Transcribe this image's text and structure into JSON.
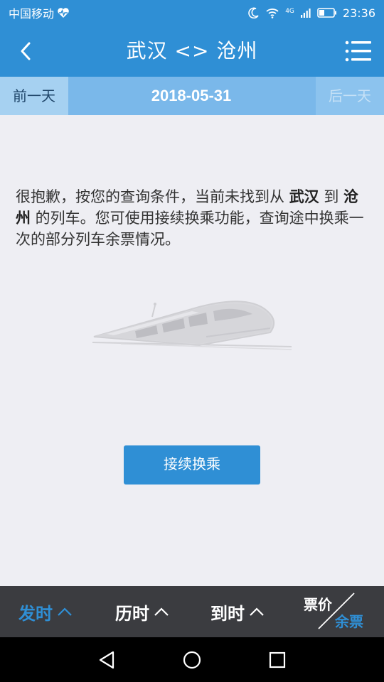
{
  "status_bar": {
    "carrier": "中国移动",
    "network": "4G",
    "time": "23:36"
  },
  "header": {
    "title": "武汉 <> 沧州"
  },
  "date_bar": {
    "prev_label": "前一天",
    "date": "2018-05-31",
    "next_label": "后一天"
  },
  "message": {
    "part1": "很抱歉，按您的查询条件，当前未找到从 ",
    "from": "武汉",
    "part2": " 到 ",
    "to": "沧州",
    "part3": " 的列车。您可使用接续换乘功能，查询途中换乘一次的部分列车余票情况。"
  },
  "transfer_button": {
    "label": "接续换乘"
  },
  "sort_bar": {
    "depart_label": "发时",
    "duration_label": "历时",
    "arrive_label": "到时",
    "price_label": "票价",
    "stock_label": "余票"
  },
  "colors": {
    "accent": "#2f8fd5",
    "sort_bar_bg": "#3b3c40"
  },
  "icons": {
    "back": "chevron-left-icon",
    "menu": "menu-list-icon",
    "sort": "chevron-up-icon",
    "nav_back": "triangle-back-icon",
    "nav_home": "circle-home-icon",
    "nav_recent": "square-recent-icon"
  }
}
